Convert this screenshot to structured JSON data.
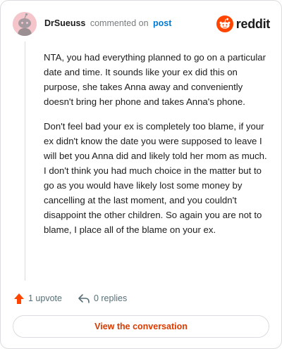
{
  "header": {
    "username": "DrSueuss",
    "action_text": "commented on",
    "link_text": "post",
    "logo_icon": "reddit-logo-icon",
    "logo_text": "reddit"
  },
  "comment": {
    "paragraphs": [
      "NTA, you had everything planned to go on a particular date and time. It sounds like your ex did this on purpose, she takes Anna away and conveniently doesn't bring her phone and takes Anna's phone.",
      "Don't feel bad your ex is completely too blame, if your ex didn't know the date you were supposed to leave I will bet you Anna did and likely told her mom as much. I don't think you had much choice in the matter but to go as you would have likely lost some money by cancelling at the last moment, and you couldn't disappoint the other children. So again you are not to blame, I place all of the blame on your ex."
    ]
  },
  "actions": {
    "upvote_label": "1 upvote",
    "upvote_icon": "upvote-arrow-icon",
    "replies_label": "0 replies",
    "replies_icon": "reply-arrow-icon"
  },
  "footer": {
    "view_label": "View the conversation"
  },
  "colors": {
    "brand": "#ff4500",
    "link": "#0079d3",
    "cta_text": "#d93a00",
    "muted": "#576f76",
    "border": "#dadce0"
  }
}
